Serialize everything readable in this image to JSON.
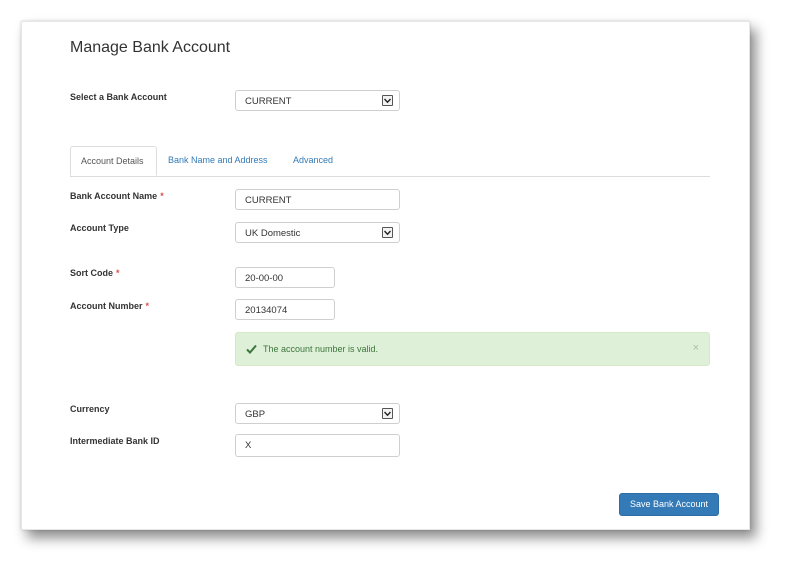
{
  "page": {
    "title": "Manage Bank Account"
  },
  "select_account": {
    "label": "Select a Bank Account",
    "value": "CURRENT"
  },
  "tabs": [
    {
      "label": "Account Details",
      "active": true
    },
    {
      "label": "Bank Name and Address",
      "active": false
    },
    {
      "label": "Advanced",
      "active": false
    }
  ],
  "form": {
    "account_name": {
      "label": "Bank Account Name",
      "required_mark": "*",
      "value": "CURRENT"
    },
    "account_type": {
      "label": "Account Type",
      "value": "UK Domestic"
    },
    "sort_code": {
      "label": "Sort Code",
      "required_mark": "*",
      "value": "20-00-00"
    },
    "account_number": {
      "label": "Account Number",
      "required_mark": "*",
      "value": "20134074"
    },
    "validation": {
      "message": "The account number is valid.",
      "close": "×",
      "icon": "checkmark-icon"
    },
    "currency": {
      "label": "Currency",
      "value": "GBP"
    },
    "intermediate_bank": {
      "label": "Intermediate Bank ID",
      "value": "X"
    }
  },
  "actions": {
    "save_label": "Save Bank Account"
  },
  "colors": {
    "primary": "#337ab7",
    "required": "#d9534f",
    "success_bg": "#dff0d8",
    "success_text": "#3c763d"
  }
}
